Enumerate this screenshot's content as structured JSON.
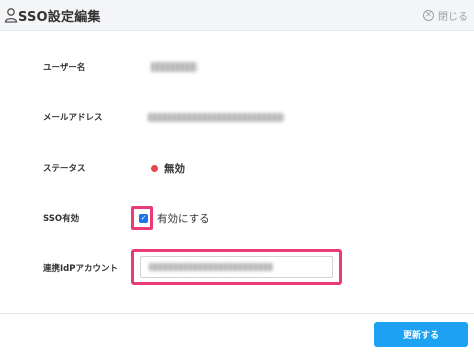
{
  "header": {
    "title": "SSO設定編集",
    "close_label": "閉じる",
    "icons": {
      "title_icon": "user-icon",
      "close_icon": "close-circle-icon"
    }
  },
  "form": {
    "username": {
      "label": "ユーザー名"
    },
    "email": {
      "label": "メールアドレス"
    },
    "status": {
      "label": "ステータス",
      "value": "無効",
      "color": "#e8454d"
    },
    "sso_enabled": {
      "label": "SSO有効",
      "checked": true,
      "checkbox_label": "有効にする",
      "color": "#1a73e8"
    },
    "linked_idp_account": {
      "label": "連携IdPアカウント"
    }
  },
  "highlight_color": "#ea3a7a",
  "footer": {
    "update_label": "更新する",
    "update_color": "#1da1f2"
  }
}
